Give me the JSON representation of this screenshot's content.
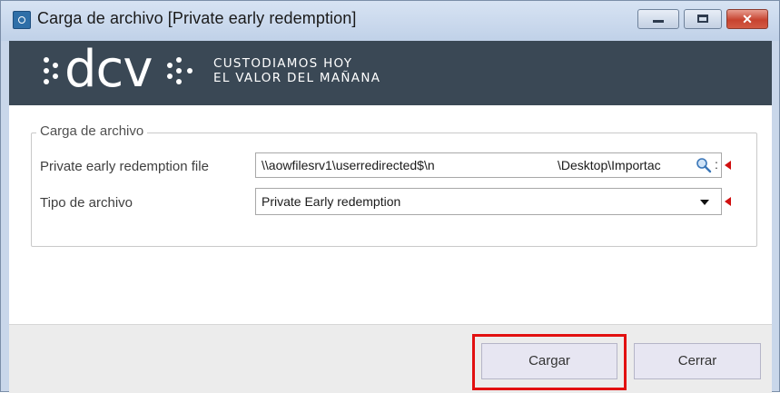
{
  "window": {
    "title": "Carga de archivo [Private early redemption]",
    "controls": {
      "minimize": "–",
      "maximize": "□",
      "close": "✕"
    }
  },
  "banner": {
    "logo_text": "dcv",
    "slogan_line1": "CUSTODIAMOS HOY",
    "slogan_line2": "EL VALOR DEL MAÑANA"
  },
  "form": {
    "group_title": "Carga de archivo",
    "file_label": "Private early redemption file",
    "file_value_start": "\\\\aowfilesrv1\\userredirected$\\n",
    "file_value_end": "\\Desktop\\Importac",
    "file_more": ":",
    "type_label": "Tipo de archivo",
    "type_value": "Private Early redemption"
  },
  "buttons": {
    "load": "Cargar",
    "close": "Cerrar"
  },
  "colors": {
    "banner": "#3a4855",
    "required_marker": "#d01010",
    "highlight": "#e21010"
  },
  "icons": {
    "app": "app-icon",
    "browse": "search-icon",
    "dropdown": "chevron-down-icon",
    "required": "required-indicator-icon"
  }
}
